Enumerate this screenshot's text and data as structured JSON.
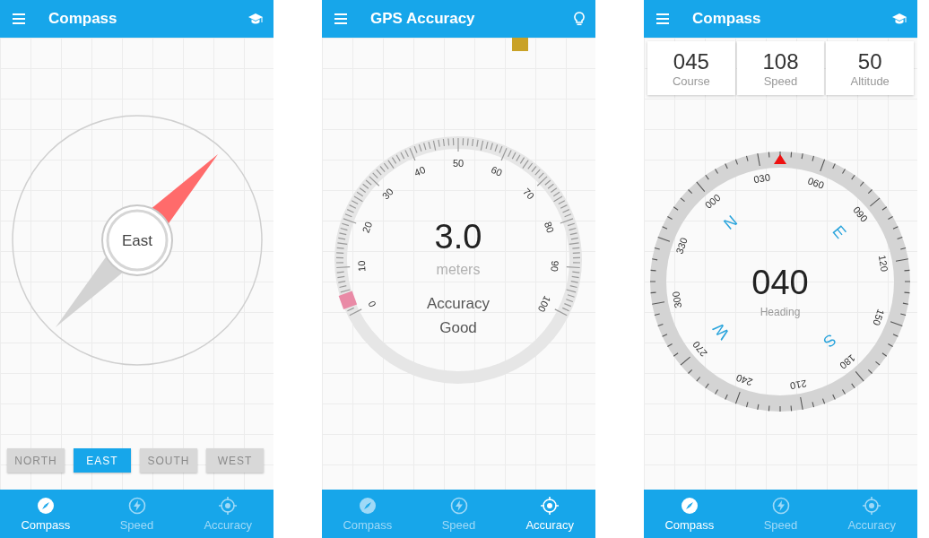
{
  "screens": [
    {
      "kind": "compass",
      "app_bar": {
        "title": "Compass",
        "action_icon": {
          "kind": "cap"
        }
      },
      "heading_label": "East",
      "direction_buttons": [
        {
          "label": "NORTH",
          "selected": false
        },
        {
          "label": "EAST",
          "selected": true
        },
        {
          "label": "SOUTH",
          "selected": false
        },
        {
          "label": "WEST",
          "selected": false
        }
      ],
      "nav": [
        {
          "kind": "compass",
          "label": "Compass",
          "selected": true
        },
        {
          "kind": "speed",
          "label": "Speed",
          "selected": false
        },
        {
          "kind": "target",
          "label": "Accuracy",
          "selected": false
        }
      ]
    },
    {
      "kind": "gps",
      "app_bar": {
        "title": "GPS Accuracy",
        "action_icon": {
          "kind": "bulb"
        }
      },
      "gauge": {
        "scale_labels": [
          "0",
          "10",
          "20",
          "30",
          "40",
          "50",
          "60",
          "70",
          "80",
          "90",
          "100"
        ],
        "level": 0.03,
        "value": "3.0",
        "unit": "meters",
        "caption": "Accuracy",
        "rating": "Good"
      },
      "nav": [
        {
          "kind": "compass",
          "label": "Compass",
          "selected": false
        },
        {
          "kind": "speed",
          "label": "Speed",
          "selected": false
        },
        {
          "kind": "target",
          "label": "Accuracy",
          "selected": true
        }
      ]
    },
    {
      "kind": "heading",
      "app_bar": {
        "title": "Compass",
        "action_icon": {
          "kind": "cap"
        }
      },
      "stats": [
        {
          "value": "045",
          "label": "Course"
        },
        {
          "value": "108",
          "label": "Speed"
        },
        {
          "value": "50",
          "label": "Altitude"
        }
      ],
      "dial": {
        "scale_labels": [
          "000",
          "030",
          "060",
          "090",
          "120",
          "150",
          "180",
          "210",
          "240",
          "270",
          "300",
          "330"
        ],
        "cardinals": [
          "N",
          "E",
          "S",
          "W"
        ],
        "value": "040",
        "caption": "Heading"
      },
      "nav": [
        {
          "kind": "compass",
          "label": "Compass",
          "selected": true
        },
        {
          "kind": "speed",
          "label": "Speed",
          "selected": false
        },
        {
          "kind": "target",
          "label": "Accuracy",
          "selected": false
        }
      ]
    }
  ]
}
